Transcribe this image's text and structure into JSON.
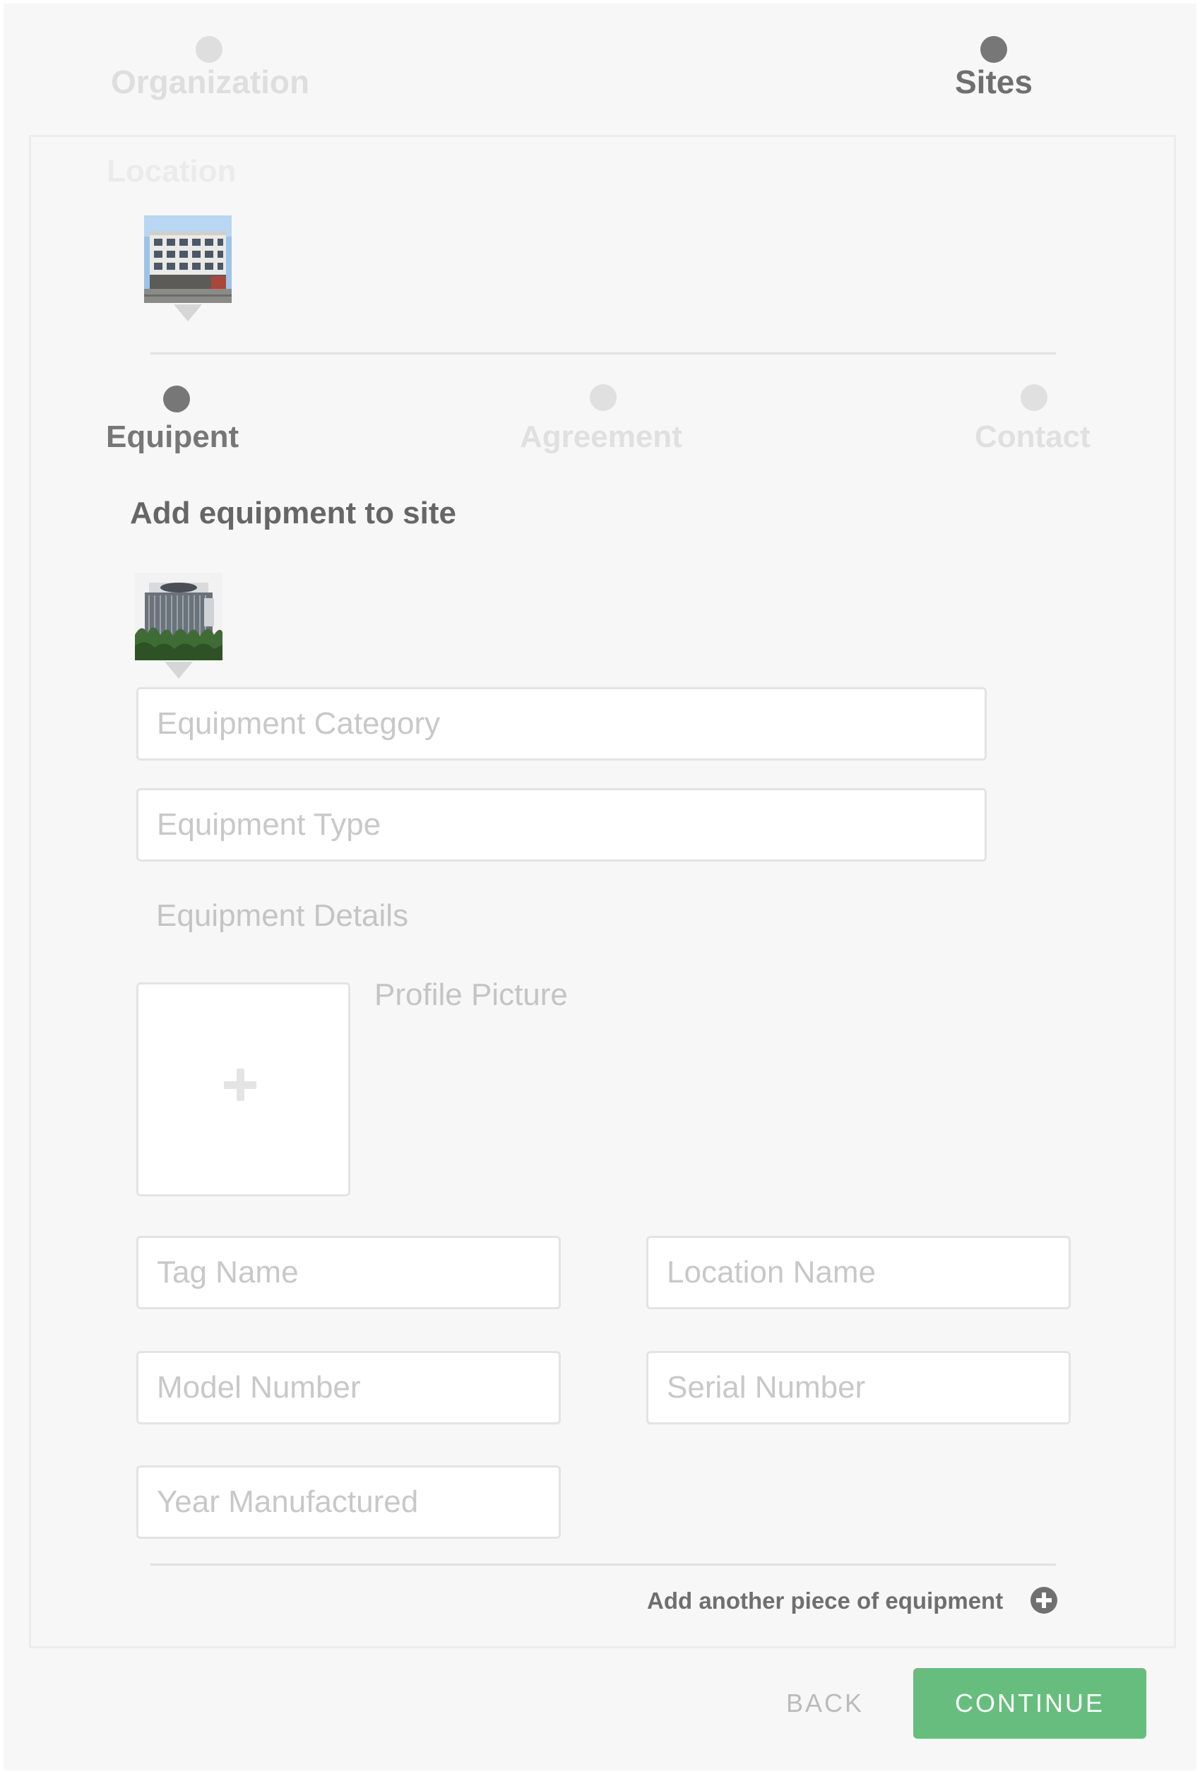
{
  "wizard": {
    "steps": [
      {
        "label": "Organization",
        "state": "inactive"
      },
      {
        "label": "Sites",
        "state": "active"
      }
    ]
  },
  "location": {
    "heading": "Location",
    "image_icon": "building-photo"
  },
  "site_steps": [
    {
      "label": "Equipent",
      "state": "active"
    },
    {
      "label": "Agreement",
      "state": "inactive"
    },
    {
      "label": "Contact",
      "state": "inactive"
    }
  ],
  "equipment": {
    "title": "Add equipment to site",
    "image_icon": "ac-unit-photo",
    "category_placeholder": "Equipment Category",
    "type_placeholder": "Equipment Type",
    "details_label": "Equipment Details",
    "profile_picture_label": "Profile Picture",
    "upload_icon": "plus-icon",
    "tag_name_placeholder": "Tag Name",
    "location_name_placeholder": "Location Name",
    "model_number_placeholder": "Model Number",
    "serial_number_placeholder": "Serial Number",
    "year_manufactured_placeholder": "Year Manufactured",
    "add_another_label": "Add another piece of equipment",
    "add_icon": "plus-circle-icon"
  },
  "actions": {
    "back_label": "BACK",
    "continue_label": "CONTINUE"
  },
  "colors": {
    "accent": "#67bd7d",
    "active_step": "#777777",
    "inactive_step": "#dedede"
  }
}
